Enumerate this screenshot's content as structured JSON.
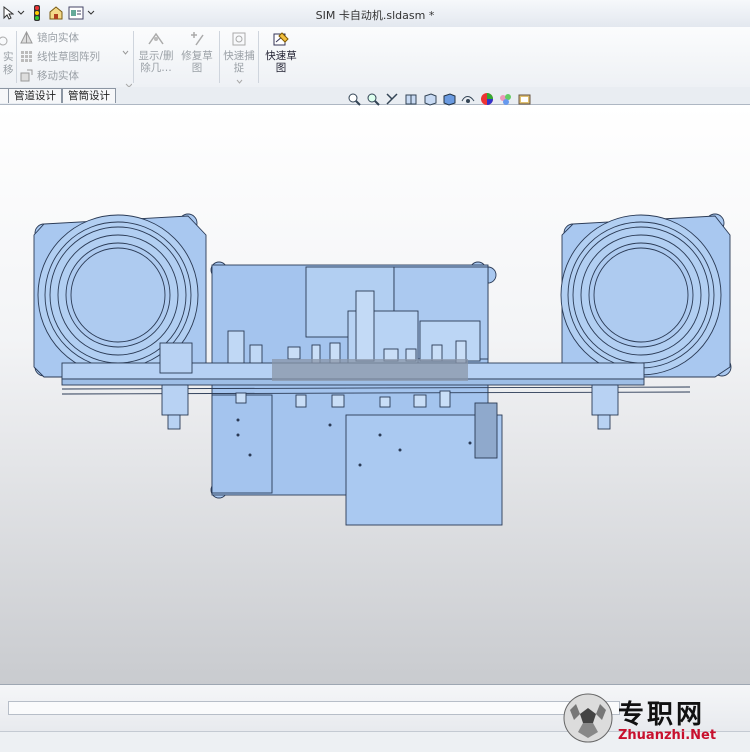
{
  "window": {
    "title": "SIM 卡自动机.sldasm *"
  },
  "ribbon": {
    "left_fragment_1": "实",
    "left_fragment_2": "移",
    "mirror_entity": "镜向实体",
    "linear_pattern": "线性草图阵列",
    "move_entity": "移动实体",
    "show_hide_1": "显示/删",
    "show_hide_2": "除几…",
    "repair_1": "修复草",
    "repair_2": "图",
    "quick_snap_1": "快速捕",
    "quick_snap_2": "捉",
    "quick_sketch_1": "快速草",
    "quick_sketch_2": "图"
  },
  "tabs": [
    {
      "label": "管道设计"
    },
    {
      "label": "管筒设计"
    }
  ],
  "watermark": {
    "cn": "专职网",
    "en": "Zhuanzhi.Net"
  },
  "colors": {
    "part_fill": "#a9c8f0",
    "part_stroke": "#2a3a55",
    "accent": "#2a6ad4"
  }
}
